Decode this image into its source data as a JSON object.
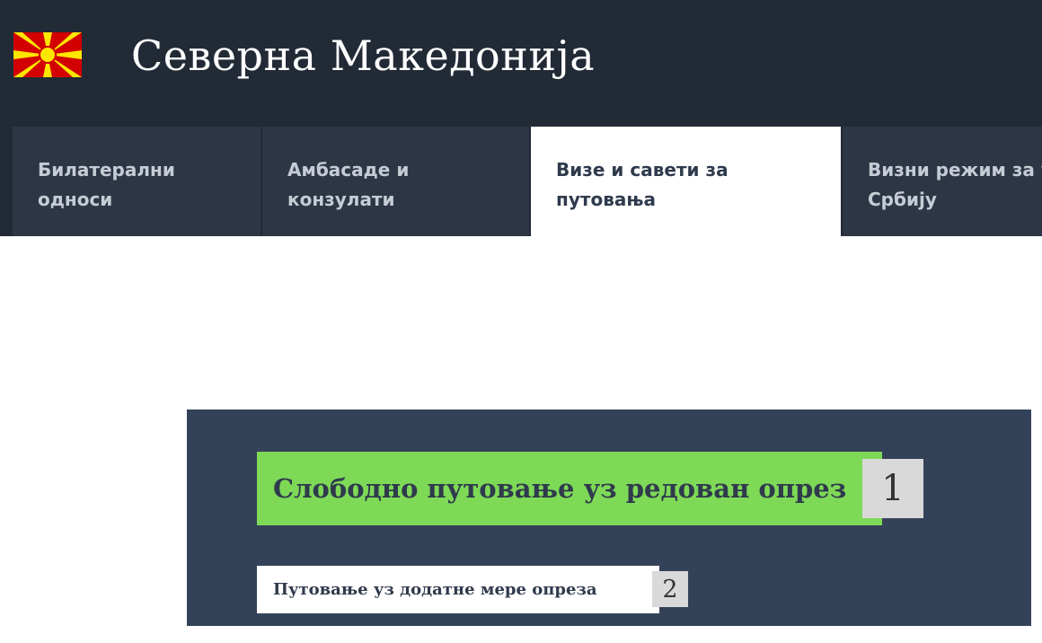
{
  "header": {
    "title": "Северна Македонија",
    "flag_icon": "north-macedonia-flag-icon",
    "flag_colors": {
      "field": "#d20000",
      "sun": "#ffe600"
    }
  },
  "nav": {
    "tabs": [
      {
        "label": "Билатерални односи",
        "active": false
      },
      {
        "label": "Амбасаде и конзулати",
        "active": false
      },
      {
        "label": "Визе и савети за путовања",
        "active": true
      },
      {
        "label": "Визни режим за улазак у Србију",
        "active": false
      }
    ]
  },
  "advisory": {
    "options": [
      {
        "label": "Слободно путовање уз редован опрез",
        "number": "1",
        "selected": true
      },
      {
        "label": "Путовање уз додатне мере опреза",
        "number": "2",
        "selected": false
      }
    ],
    "colors": {
      "panel": "#344259",
      "selected": "#7ed957",
      "unselected": "#ffffff"
    }
  }
}
